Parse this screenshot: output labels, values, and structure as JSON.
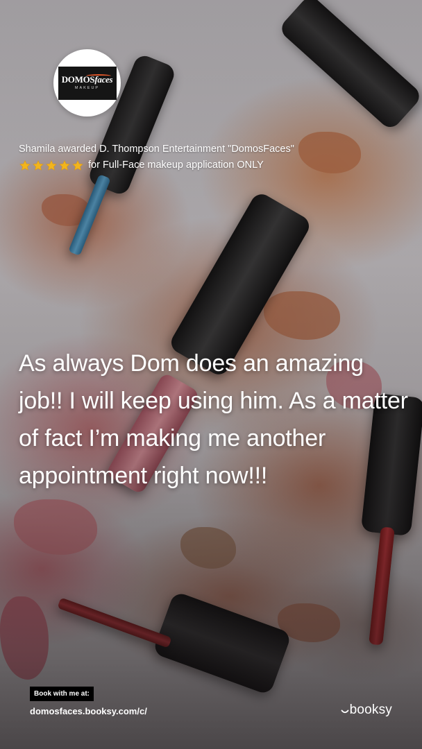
{
  "logo": {
    "main_text_1": "DOMOS",
    "main_text_2": "faces",
    "sub_text": "MAKEUP",
    "accent_color": "#e2572a"
  },
  "review": {
    "headline": "Shamila awarded D. Thompson Entertainment \"DomosFaces\"",
    "rating": 5,
    "rating_icon": "star-icon",
    "star_color": "#f2b51d",
    "service_text": "for Full-Face makeup application ONLY",
    "quote": "As always Dom does an amazing job!! I will keep using him. As a matter of fact I’m making me another appointment right now!!!"
  },
  "footer": {
    "book_label": "Book with me at:",
    "book_url": "domosfaces.booksy.com/c/",
    "brand_name": "booksy",
    "brand_icon": "booksy-smile-icon"
  }
}
